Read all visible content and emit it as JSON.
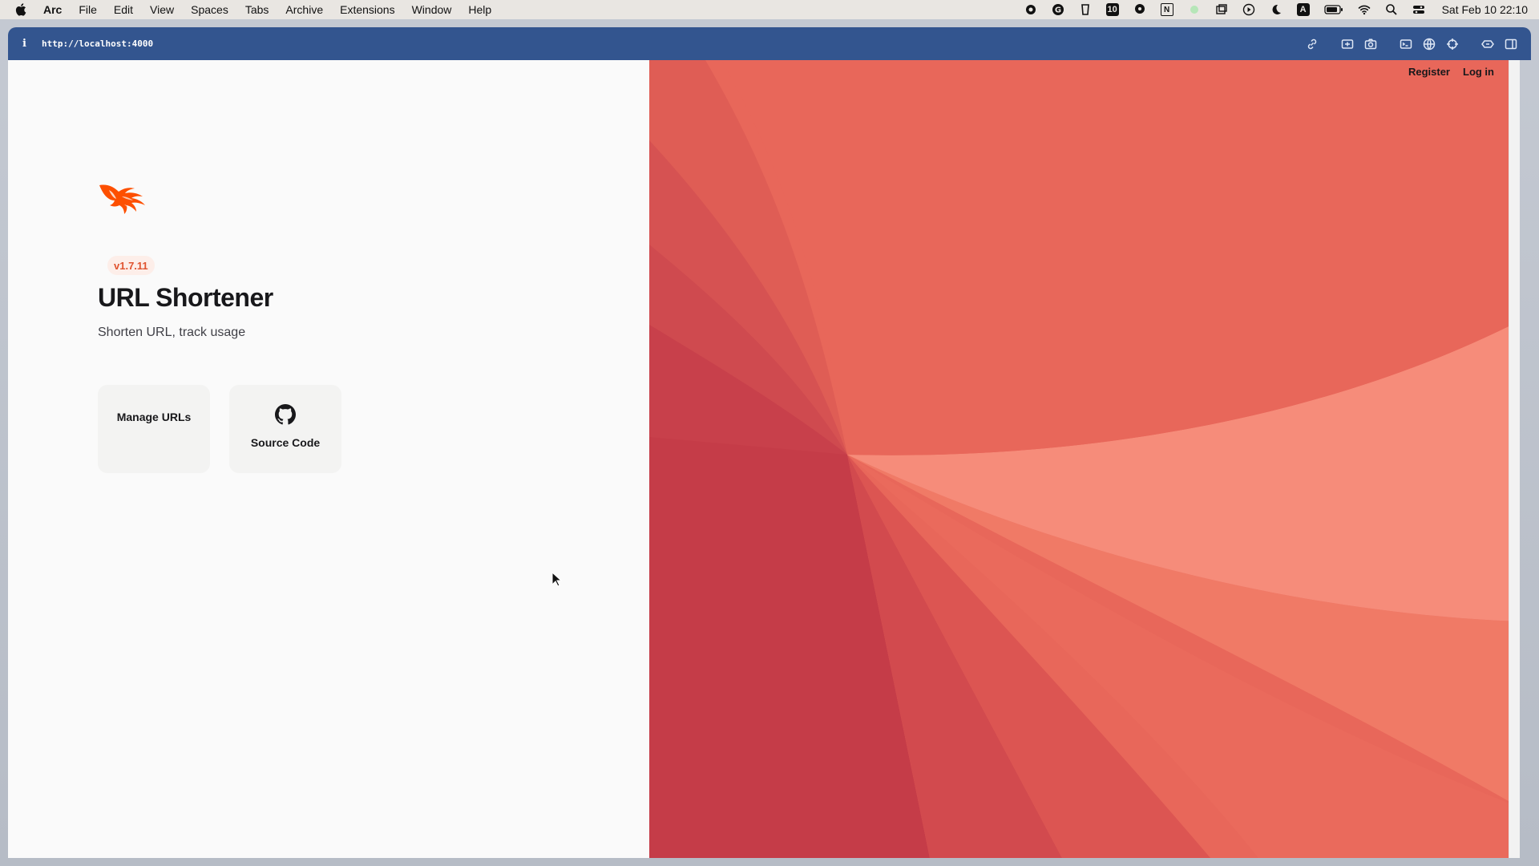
{
  "menubar": {
    "app_name": "Arc",
    "items": [
      "File",
      "Edit",
      "View",
      "Spaces",
      "Tabs",
      "Archive",
      "Extensions",
      "Window",
      "Help"
    ],
    "tray_badge": "10",
    "tray_letter_a": "A",
    "tray_letter_n": "N",
    "clock": "Sat Feb 10  22:10"
  },
  "browser": {
    "info_icon": "i",
    "url": "http://localhost:4000",
    "tools": [
      "link-icon",
      "capture-icon",
      "camera-icon",
      "terminal-icon",
      "globe-icon",
      "target-icon",
      "extensions-icon",
      "sidebar-icon"
    ]
  },
  "page": {
    "version": "v1.7.11",
    "title": "URL Shortener",
    "subtitle": "Shorten URL, track usage",
    "cards": {
      "manage_label": "Manage URLs",
      "source_label": "Source Code"
    },
    "auth": {
      "register": "Register",
      "login": "Log in"
    },
    "accent_color": "#fd4f00"
  }
}
